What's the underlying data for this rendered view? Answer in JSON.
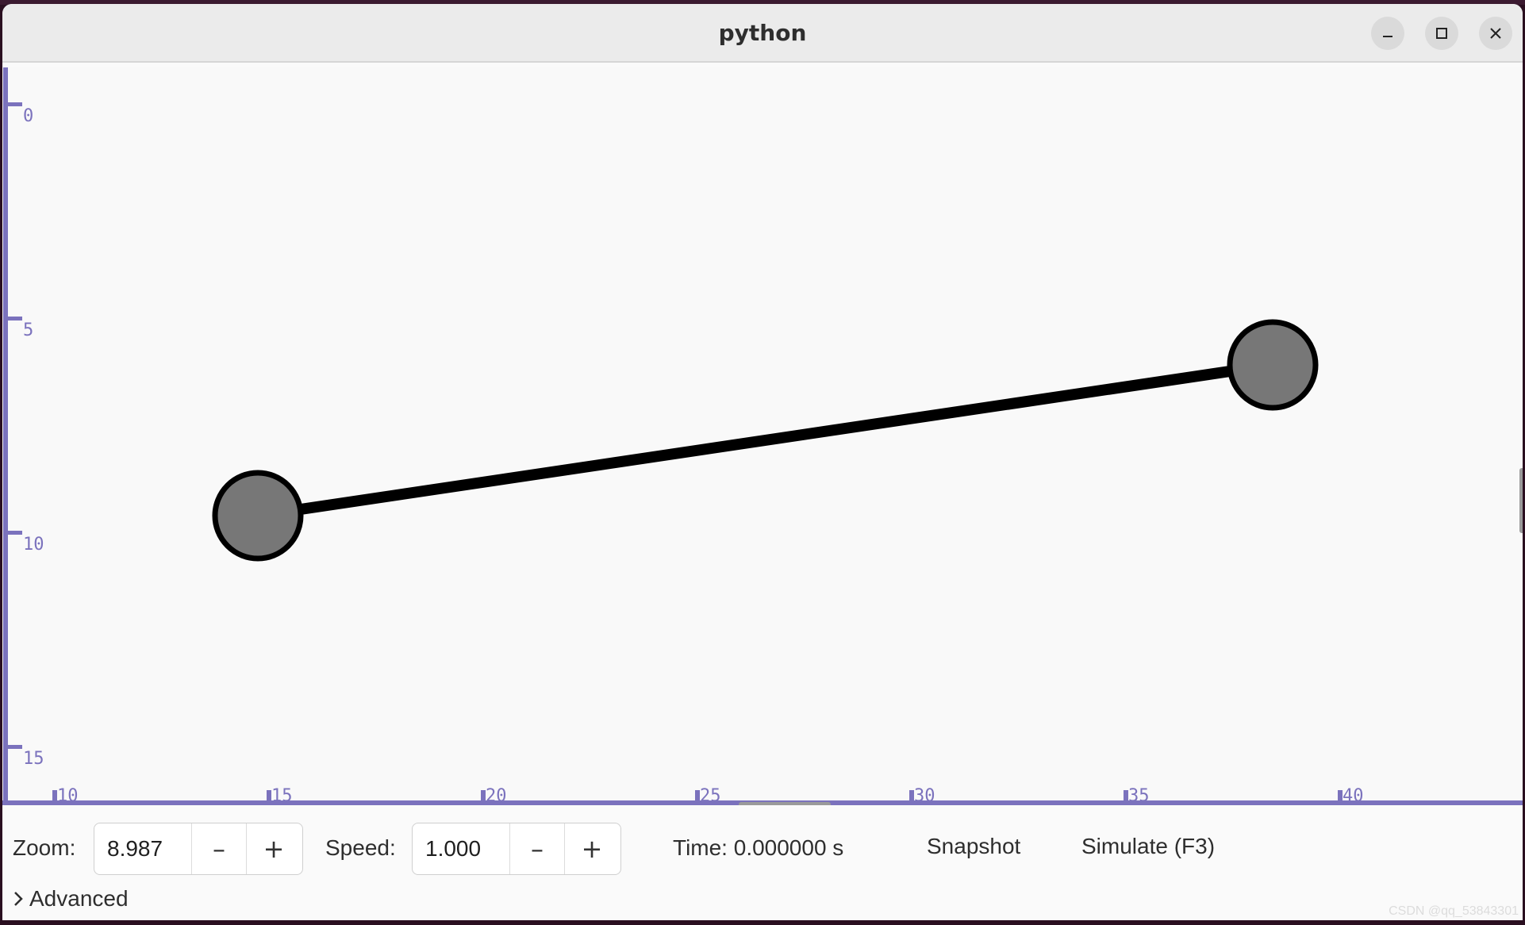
{
  "window": {
    "title": "python"
  },
  "colors": {
    "axis": "#7b72bd",
    "node_fill": "#777777",
    "node_stroke": "#000000",
    "link": "#000000"
  },
  "plot": {
    "y_ticks": [
      "0",
      "5",
      "10",
      "15"
    ],
    "x_ticks": [
      "10",
      "15",
      "20",
      "25",
      "30",
      "35",
      "40"
    ]
  },
  "controls": {
    "zoom_label": "Zoom:",
    "zoom_value": "8.987",
    "speed_label": "Speed:",
    "speed_value": "1.000",
    "minus_label": "–",
    "plus_label": "+",
    "time_text": "Time: 0.000000 s",
    "snapshot_label": "Snapshot",
    "simulate_label": "Simulate (F3)",
    "advanced_label": "Advanced"
  },
  "watermark": "CSDN @qq_53843301"
}
